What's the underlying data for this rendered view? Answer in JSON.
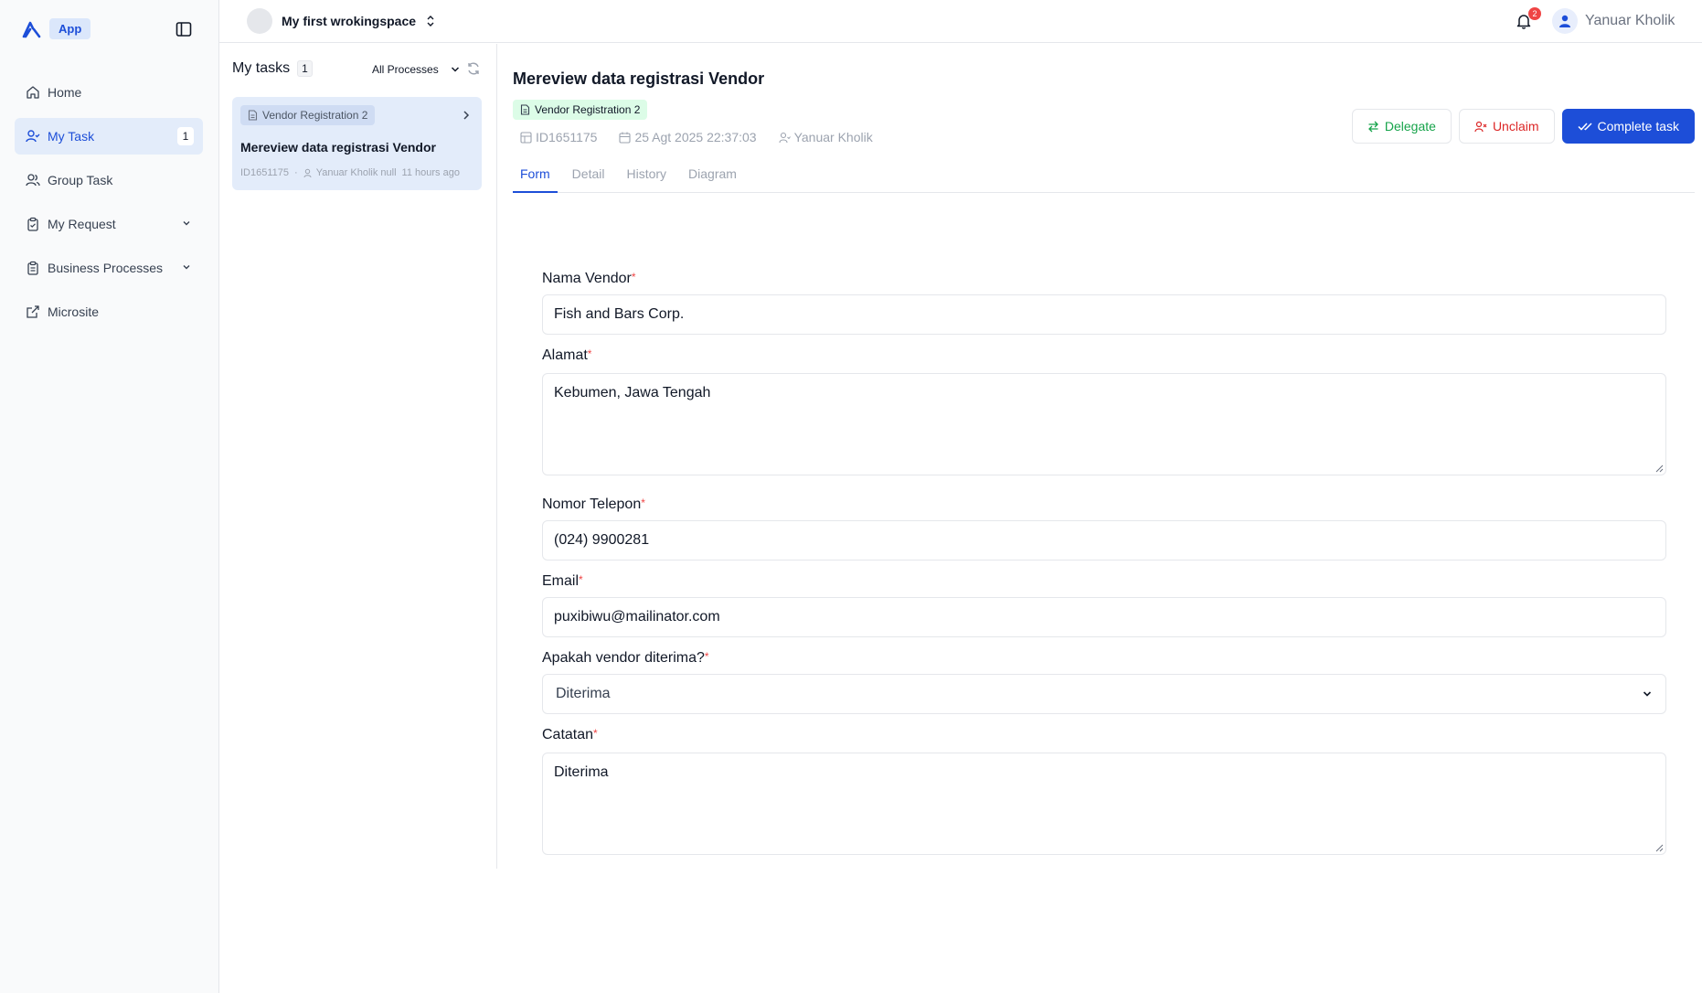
{
  "sidebar": {
    "brand_badge": "App",
    "items": [
      {
        "label": "Home",
        "icon": "home-icon"
      },
      {
        "label": "My Task",
        "icon": "user-check-icon",
        "count": "1",
        "active": true
      },
      {
        "label": "Group Task",
        "icon": "users-icon"
      },
      {
        "label": "My Request",
        "icon": "clipboard-icon"
      },
      {
        "label": "Business Processes",
        "icon": "clipboard-list-icon"
      },
      {
        "label": "Microsite",
        "icon": "external-link-icon"
      }
    ]
  },
  "topbar": {
    "workspace_name": "My first wrokingspace",
    "notification_count": "2",
    "user_name": "Yanuar Kholik"
  },
  "tasklist": {
    "title": "My tasks",
    "count": "1",
    "filter": "All Processes",
    "card": {
      "tag": "Vendor Registration 2",
      "title": "Mereview data registrasi Vendor",
      "id": "ID1651175",
      "dot": "·",
      "assignee": "Yanuar Kholik null",
      "time": "11 hours ago"
    }
  },
  "detail": {
    "title": "Mereview data registrasi Vendor",
    "tag": "Vendor Registration 2",
    "id": "ID1651175",
    "date": "25 Agt 2025 22:37:03",
    "assignee": "Yanuar Kholik",
    "actions": {
      "delegate": "Delegate",
      "unclaim": "Unclaim",
      "complete": "Complete task"
    },
    "tabs": [
      "Form",
      "Detail",
      "History",
      "Diagram"
    ]
  },
  "form": {
    "required_mark": "*",
    "nama_vendor": {
      "label": "Nama Vendor",
      "value": "Fish and Bars Corp."
    },
    "alamat": {
      "label": "Alamat",
      "value": "Kebumen, Jawa Tengah"
    },
    "telepon": {
      "label": "Nomor Telepon",
      "value": "(024) 9900281"
    },
    "email": {
      "label": "Email",
      "value": "puxibiwu@mailinator.com"
    },
    "diterima": {
      "label": "Apakah vendor diterima?",
      "value": "Diterima"
    },
    "catatan": {
      "label": "Catatan",
      "value": "Diterima"
    }
  },
  "colors": {
    "accent": "#1d4ed8",
    "success": "#16a34a",
    "danger": "#dc2626"
  }
}
